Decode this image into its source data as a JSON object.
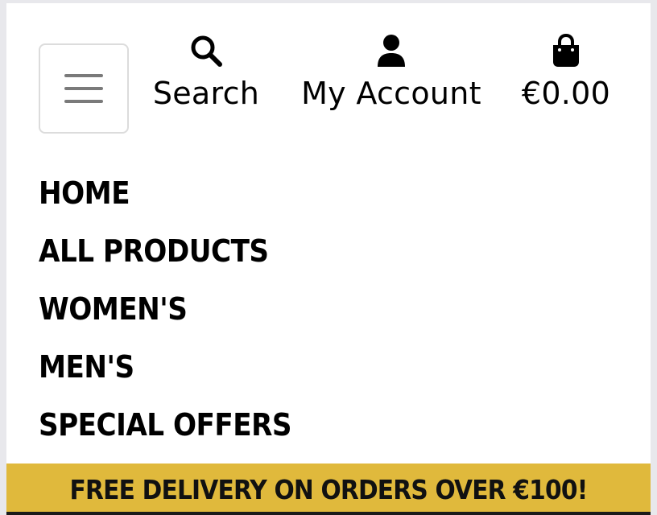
{
  "header": {
    "menu_toggle": {
      "icon": "hamburger-icon"
    },
    "tools": {
      "search": {
        "label": "Search",
        "icon": "search-icon"
      },
      "account": {
        "label": "My Account",
        "icon": "user-icon"
      },
      "bag": {
        "label": "€0.00",
        "icon": "shopping-bag-icon"
      }
    }
  },
  "nav": {
    "items": [
      {
        "label": "HOME"
      },
      {
        "label": "ALL PRODUCTS"
      },
      {
        "label": "WOMEN'S"
      },
      {
        "label": "MEN'S"
      },
      {
        "label": "SPECIAL OFFERS"
      }
    ]
  },
  "banner": {
    "text": "FREE DELIVERY ON ORDERS OVER €100!"
  },
  "colors": {
    "banner_bg": "#e0b93c",
    "text": "#000000",
    "toggle_border": "#dcdcdc",
    "toggle_bars": "#7a7a7a"
  }
}
